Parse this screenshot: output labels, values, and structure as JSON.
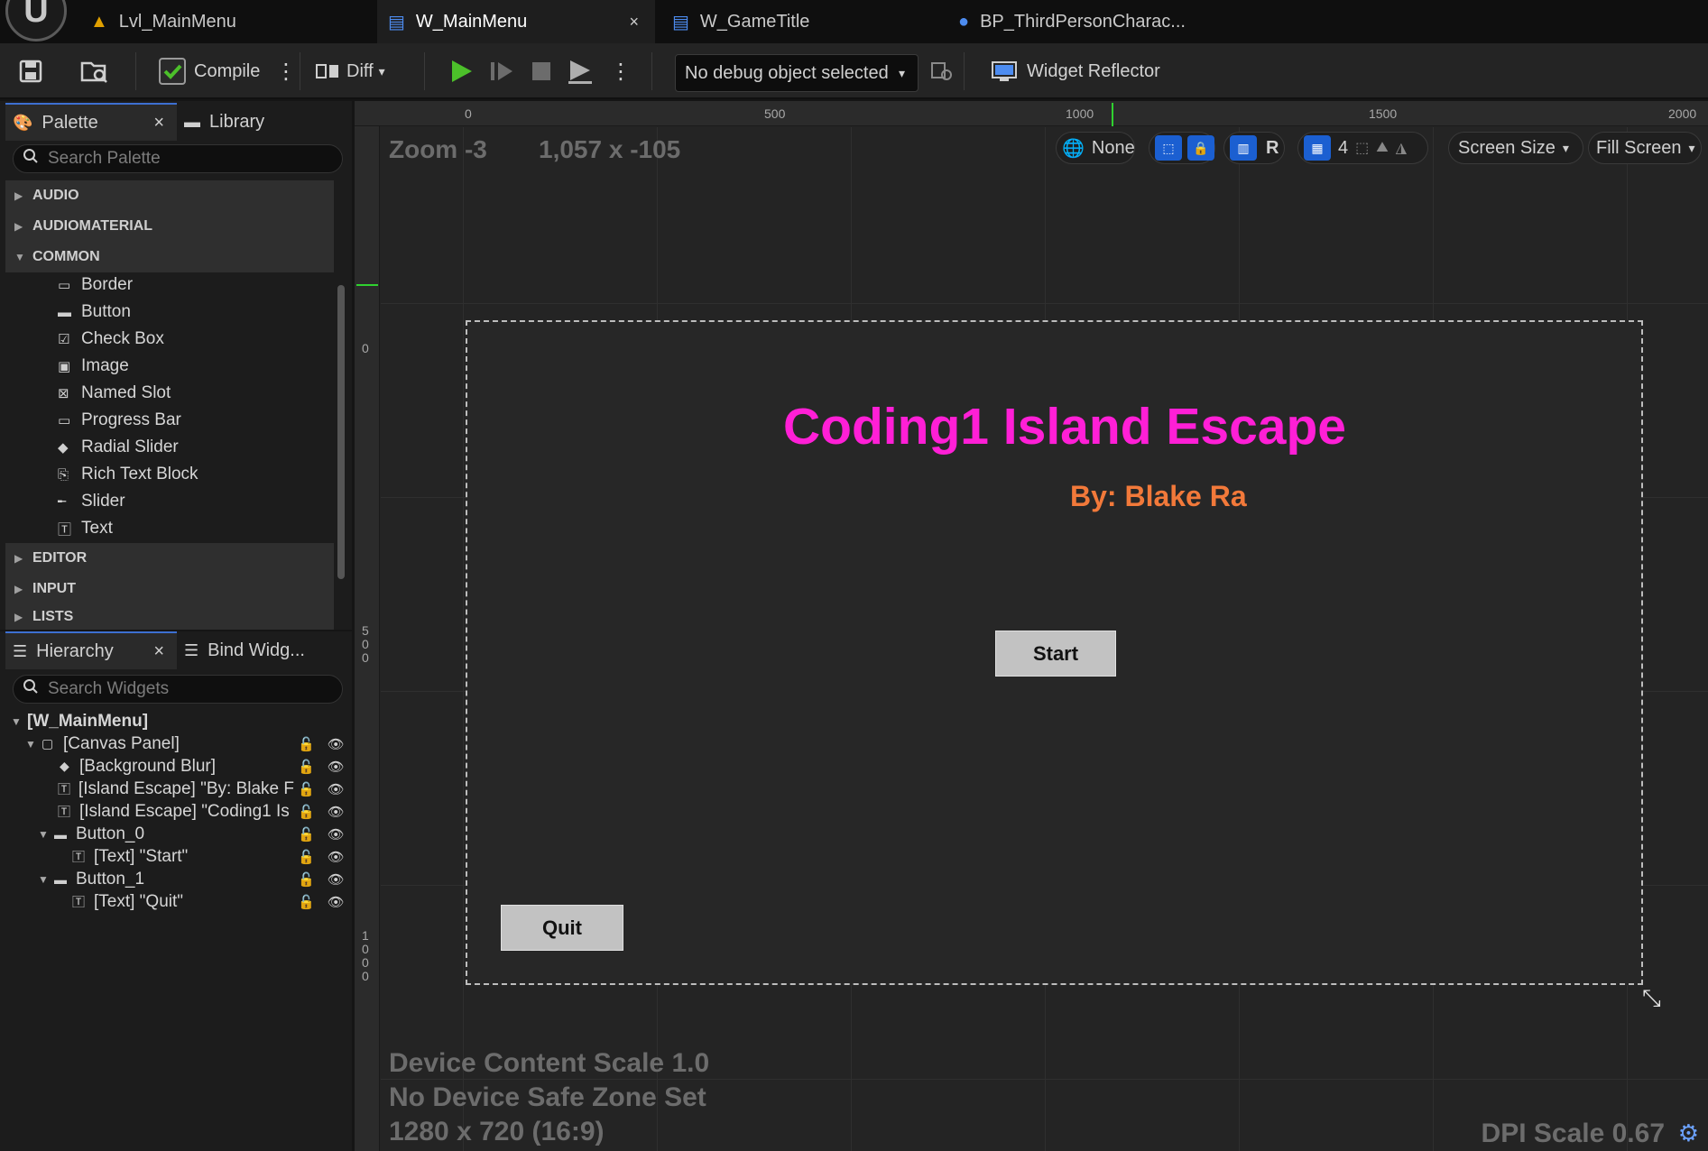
{
  "tabs": {
    "items": [
      {
        "label": "Lvl_MainMenu",
        "icon": "level-icon"
      },
      {
        "label": "W_MainMenu",
        "icon": "widget-blueprint-icon",
        "active": true
      },
      {
        "label": "W_GameTitle",
        "icon": "widget-blueprint-icon"
      },
      {
        "label": "BP_ThirdPersonCharac...",
        "icon": "character-icon"
      }
    ],
    "close_glyph": "×"
  },
  "toolbar": {
    "compile_label": "Compile",
    "diff_label": "Diff",
    "debug_select_value": "No debug object selected",
    "widget_reflector_label": "Widget Reflector"
  },
  "palette": {
    "tab_label": "Palette",
    "library_tab_label": "Library",
    "search_placeholder": "Search Palette",
    "categories": {
      "audio": "AUDIO",
      "audiomaterial": "AUDIOMATERIAL",
      "common": "COMMON",
      "editor": "EDITOR",
      "input": "INPUT",
      "lists": "LISTS"
    },
    "common_items": [
      "Border",
      "Button",
      "Check Box",
      "Image",
      "Named Slot",
      "Progress Bar",
      "Radial Slider",
      "Rich Text Block",
      "Slider",
      "Text"
    ]
  },
  "hierarchy": {
    "tab_label": "Hierarchy",
    "bind_tab_label": "Bind Widg...",
    "search_placeholder": "Search Widgets",
    "rows": [
      "[W_MainMenu]",
      "[Canvas Panel]",
      "[Background Blur]",
      "[Island Escape] \"By: Blake F",
      "[Island Escape] \"Coding1 Is",
      "Button_0",
      "[Text] \"Start\"",
      "Button_1",
      "[Text] \"Quit\""
    ]
  },
  "designer": {
    "zoom": "Zoom -3",
    "cursor_coords": "1,057 x -105",
    "ruler_top": [
      "0",
      "500",
      "1000",
      "1500",
      "2000"
    ],
    "ruler_left": [
      "0",
      "5\n0\n0",
      "1\n0\n0\n0"
    ],
    "localization": "None",
    "grid_snap": "4",
    "respect_locks_label": "R",
    "screen_size": "Screen Size",
    "fill_screen": "Fill Screen",
    "title": "Coding1 Island Escape",
    "byline": "By: Blake Ra",
    "start_button": "Start",
    "quit_button": "Quit",
    "device_content_scale": "Device Content Scale 1.0",
    "safe_zone": "No Device Safe Zone Set",
    "resolution": "1280 x 720 (16:9)",
    "dpi_scale": "DPI Scale 0.67"
  },
  "colors": {
    "title": "#ff1fd6",
    "byline": "#f2793a",
    "accent_blue": "#1b5fd1",
    "play_green": "#4cc02a"
  }
}
